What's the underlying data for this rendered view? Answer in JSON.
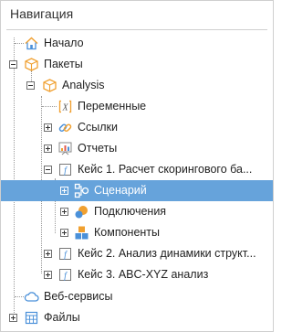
{
  "panel": {
    "title": "Навигация"
  },
  "tree": {
    "home": "Начало",
    "packages": "Пакеты",
    "analysis": "Analysis",
    "variables": "Переменные",
    "links": "Ссылки",
    "reports": "Отчеты",
    "case1": "Кейс 1. Расчет скорингового ба...",
    "scenario": "Сценарий",
    "connections": "Подключения",
    "components": "Компоненты",
    "case2": "Кейс 2. Анализ динамики структ...",
    "case3": "Кейс 3. ABC-XYZ анализ",
    "webservices": "Веб-сервисы",
    "files": "Файлы"
  },
  "colors": {
    "selection": "#66a3db",
    "icon_orange": "#f0a030",
    "icon_blue": "#4a90d9"
  }
}
